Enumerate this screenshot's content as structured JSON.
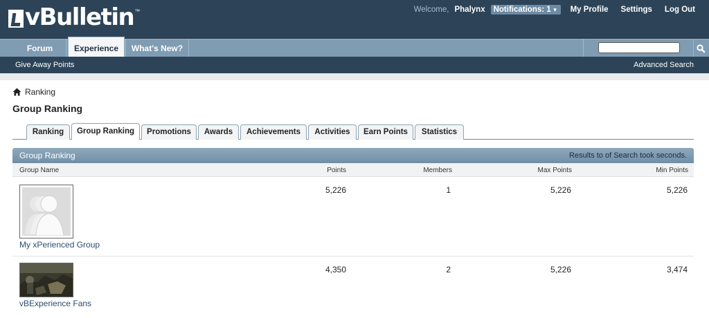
{
  "header": {
    "logo_text": "vBulletin",
    "logo_tm": "™",
    "welcome": "Welcome,",
    "username": "Phalynx",
    "notifications_label": "Notifications: 1",
    "links": [
      "My Profile",
      "Settings",
      "Log Out"
    ]
  },
  "nav": {
    "tabs": [
      "Forum",
      "Experience",
      "What's New?"
    ],
    "active_tab": "Experience",
    "search_placeholder": ""
  },
  "subnav": {
    "left": "Give Away Points",
    "right": "Advanced Search"
  },
  "breadcrumb": "Ranking",
  "page_title": "Group Ranking",
  "page_tabs": [
    "Ranking",
    "Group Ranking",
    "Promotions",
    "Awards",
    "Achievements",
    "Activities",
    "Earn Points",
    "Statistics"
  ],
  "active_page_tab": "Group Ranking",
  "block": {
    "title": "Group Ranking",
    "right_text": "Results to of Search took seconds."
  },
  "columns": [
    "Group Name",
    "Points",
    "Members",
    "Max Points",
    "Min Points"
  ],
  "rows": [
    {
      "name": "My xPerienced Group",
      "points": "5,226",
      "members": "1",
      "max_points": "5,226",
      "min_points": "5,226",
      "avatar": "default-group-avatar"
    },
    {
      "name": "vBExperience Fans",
      "points": "4,350",
      "members": "2",
      "max_points": "5,226",
      "min_points": "3,474",
      "avatar": "group-photo"
    }
  ],
  "colors": {
    "header_bg": "#2d4458",
    "nav_bg": "#7f9cb2",
    "block_head": "#7f9cb2",
    "link": "#2a4d6e"
  }
}
